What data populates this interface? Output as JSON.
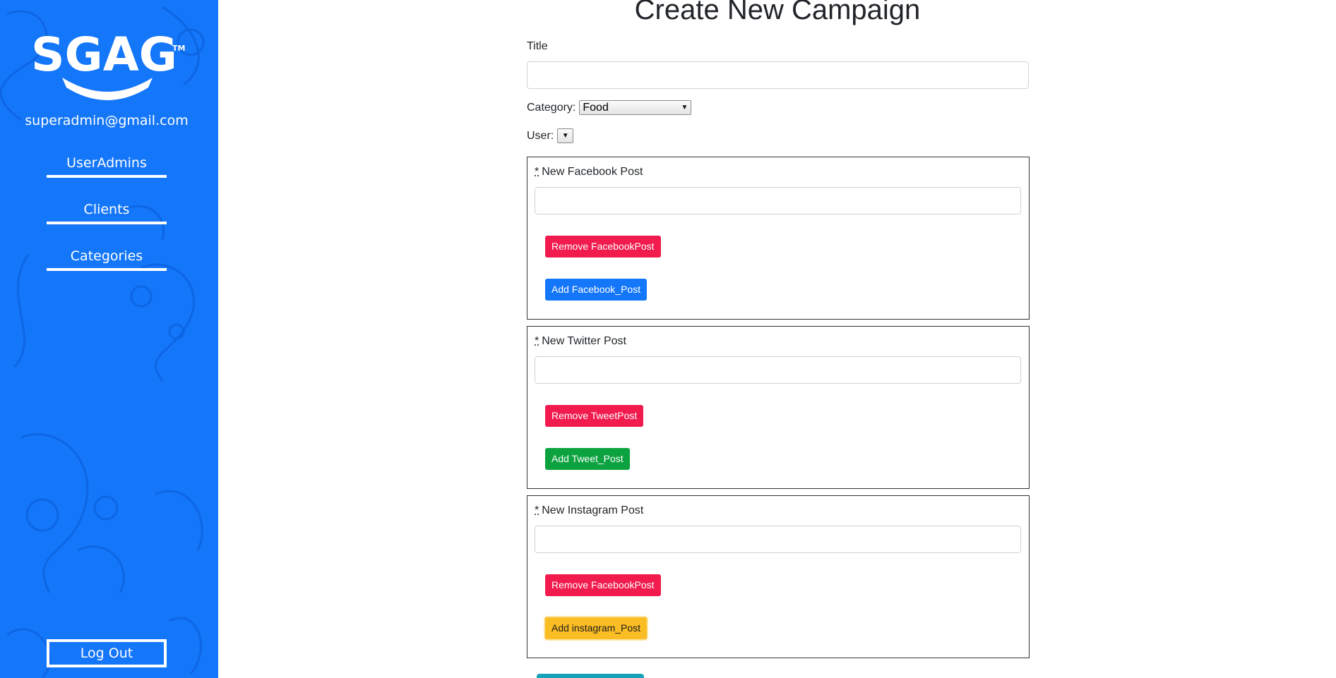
{
  "sidebar": {
    "logo_text": "SGAG",
    "logo_mark": "TM",
    "email": "superadmin@gmail.com",
    "nav": [
      {
        "label": "UserAdmins"
      },
      {
        "label": "Clients"
      },
      {
        "label": "Categories"
      }
    ],
    "logout_label": "Log Out",
    "background_color": "#1476f9"
  },
  "main": {
    "title": "Create New Campaign",
    "title_field": {
      "label": "Title",
      "value": ""
    },
    "category": {
      "label": "Category:",
      "selected": "Food"
    },
    "user": {
      "label": "User:",
      "selected": ""
    },
    "posts": [
      {
        "required_marker": "*",
        "label": "New Facebook Post",
        "value": "",
        "remove_label": "Remove FacebookPost",
        "add_label": "Add Facebook_Post",
        "add_color": "#1476f9"
      },
      {
        "required_marker": "*",
        "label": "New Twitter Post",
        "value": "",
        "remove_label": "Remove TweetPost",
        "add_label": "Add Tweet_Post",
        "add_color": "#0ba23f"
      },
      {
        "required_marker": "*",
        "label": "New Instagram Post",
        "value": "",
        "remove_label": "Remove FacebookPost",
        "add_label": "Add instagram_Post",
        "add_color": "#fbbd24"
      }
    ],
    "remove_color": "#f11b4e"
  }
}
